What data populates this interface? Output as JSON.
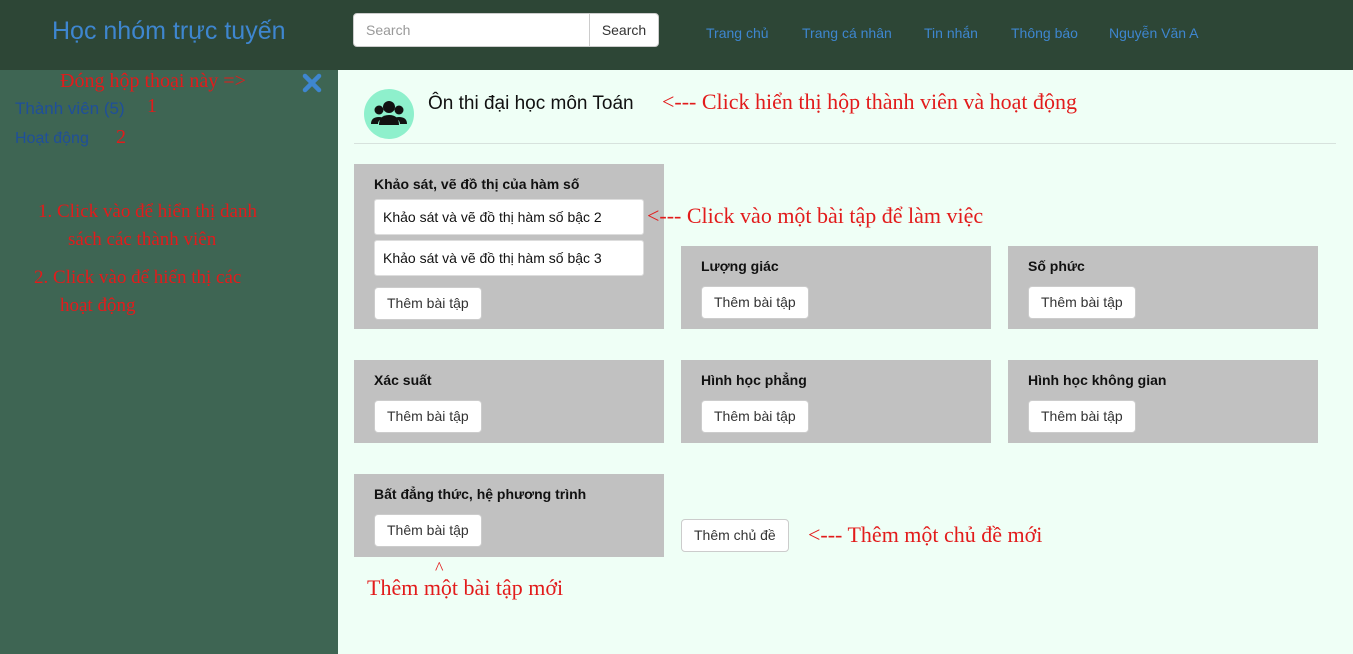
{
  "navbar": {
    "brand": "Học nhóm trực tuyến",
    "search_placeholder": "Search",
    "search_button": "Search",
    "links": [
      "Trang chủ",
      "Trang cá nhân",
      "Tin nhắn",
      "Thông báo",
      "Nguyễn Văn A"
    ],
    "link_color": "#3e86cf"
  },
  "sidebar": {
    "close_note": "Đóng hộp thoại này =>",
    "members_link": "Thành viên (5)",
    "members_marker": "1",
    "activity_link": "Hoạt động",
    "activity_marker": "2",
    "instructions": [
      {
        "line1": "1.  Click vào để hiển thị danh",
        "line2": "sách các thành viên"
      },
      {
        "line1": "2.  Click vào để hiển thị các",
        "line2": "hoạt động"
      }
    ],
    "close_icon": "close-icon"
  },
  "group": {
    "title": "Ôn thi đại học môn Toán",
    "icon": "group-users-icon",
    "note": "<--- Click hiển thị hộp thành viên và hoạt động"
  },
  "topics": [
    {
      "title": "Khảo sát, vẽ đồ thị của hàm số",
      "exercises": [
        "Khảo sát và vẽ đồ thị hàm số bậc 2",
        "Khảo sát và vẽ đồ thị hàm số bậc 3"
      ],
      "add_label": "Thêm bài tập"
    },
    {
      "title": "Lượng giác",
      "exercises": [],
      "add_label": "Thêm bài tập"
    },
    {
      "title": "Số phức",
      "exercises": [],
      "add_label": "Thêm bài tập"
    },
    {
      "title": "Xác suất",
      "exercises": [],
      "add_label": "Thêm bài tập"
    },
    {
      "title": "Hình học phẳng",
      "exercises": [],
      "add_label": "Thêm bài tập"
    },
    {
      "title": "Hình học không gian",
      "exercises": [],
      "add_label": "Thêm bài tập"
    },
    {
      "title": "Bất đẳng thức, hệ phương trình",
      "exercises": [],
      "add_label": "Thêm bài tập"
    }
  ],
  "exercise_note": "<--- Click vào một bài tập để làm việc",
  "add_topic_button": "Thêm chủ đề",
  "add_topic_note": "<---  Thêm một chủ đề mới",
  "add_exercise_caret": "^",
  "add_exercise_note": "Thêm một bài tập mới",
  "colors": {
    "navbar_bg": "#2d4636",
    "sidebar_bg": "#3e6553",
    "main_bg": "#effff6",
    "topic_bg": "#c1c1c1",
    "annotation_red": "#e21b1b",
    "avatar_bg": "#8ef0cc"
  }
}
